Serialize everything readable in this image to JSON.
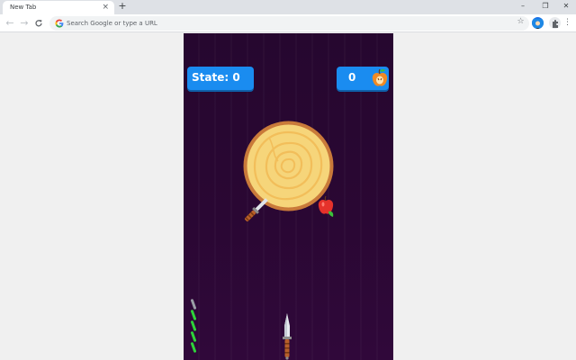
{
  "browser": {
    "tab_title": "New Tab",
    "tab_close": "×",
    "new_tab": "+",
    "minimize": "–",
    "restore": "❐",
    "close": "✕",
    "back": "←",
    "forward": "→",
    "reload": "C",
    "omnibox_placeholder": "Search Google or type a URL",
    "star": "☆",
    "menu": "⋮"
  },
  "game": {
    "state_label": "State: 0",
    "apple_count": "0",
    "knives_total": 5,
    "knives_used": 1,
    "colors": {
      "background": "#2a0733",
      "hud": "#1a8cf0",
      "log_face": "#f6d57a",
      "log_rim": "#c97a3a",
      "apple": "#e5322b",
      "knife_counter_active": "#2fd43a",
      "knife_counter_used": "#9aa0a6"
    },
    "icons": [
      "apple-icon",
      "knife-icon",
      "log-target"
    ]
  }
}
